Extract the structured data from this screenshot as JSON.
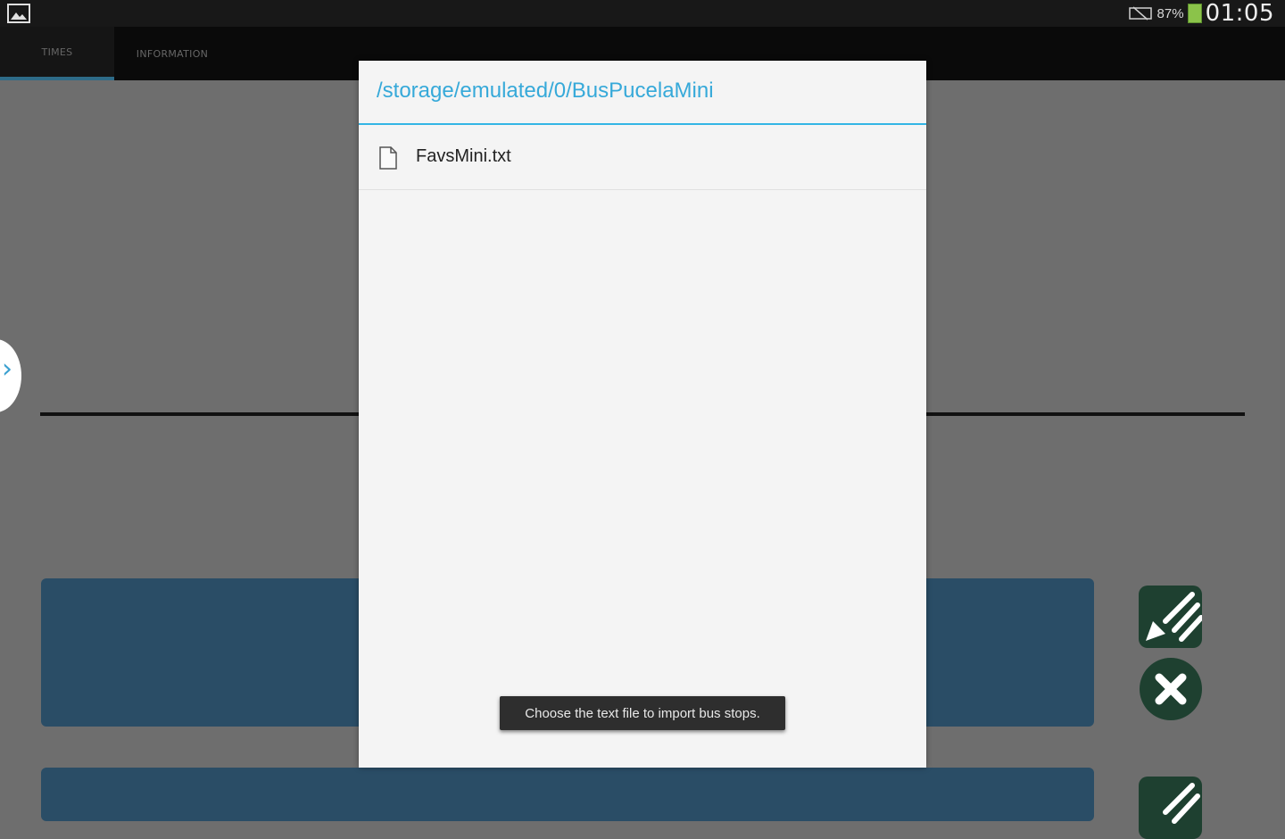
{
  "status_bar": {
    "battery_text": "87%",
    "clock": "01:05"
  },
  "tabs": [
    {
      "label": "TIMES"
    },
    {
      "label": "INFORMATION"
    }
  ],
  "dialog": {
    "title": "/storage/emulated/0/BusPucelaMini",
    "files": [
      {
        "name": "FavsMini.txt",
        "icon": "file-icon"
      }
    ]
  },
  "toast": {
    "message": "Choose the text file to import bus stops."
  },
  "colors": {
    "accent": "#33b5e5",
    "card": "#2a4d66",
    "action_button": "#1e4030",
    "battery": "#8bc34a"
  }
}
